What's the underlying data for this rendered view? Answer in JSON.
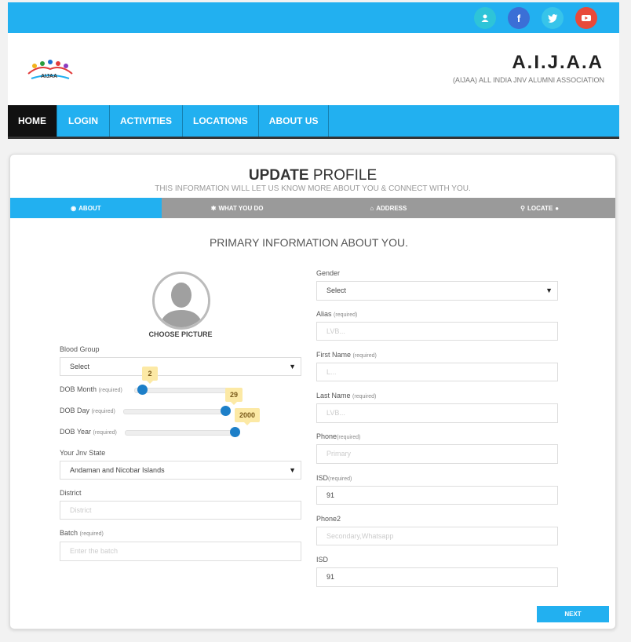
{
  "social": {
    "user_icon": "👤",
    "facebook_icon": "f",
    "twitter_icon": "🐦",
    "youtube_icon": "▶",
    "colors": {
      "user": "#2ec4d8",
      "facebook": "#3b6fd6",
      "twitter": "#37c4ea",
      "youtube": "#e8493a"
    }
  },
  "header": {
    "brand": "A.I.J.A.A",
    "brand_sub": "(AIJAA) ALL INDIA JNV ALUMNI ASSOCIATION",
    "logo_text": "AIJAA"
  },
  "nav": [
    "HOME",
    "LOGIN",
    "ACTIVITIES",
    "LOCATIONS",
    "ABOUT US"
  ],
  "page": {
    "title_bold": "UPDATE",
    "title_rest": " PROFILE",
    "subtitle": "THIS INFORMATION WILL LET US KNOW MORE ABOUT YOU & CONNECT WITH YOU.",
    "tabs": [
      "ABOUT",
      "WHAT YOU DO",
      "ADDRESS",
      "LOCATE"
    ],
    "section_title": "PRIMARY INFORMATION ABOUT YOU.",
    "choose_picture": "CHOOSE PICTURE",
    "next": "NEXT"
  },
  "left": {
    "blood_group": {
      "label": "Blood Group",
      "value": "Select"
    },
    "dob_month": {
      "label": "DOB Month",
      "req": "(required)",
      "value": "2",
      "fraction": 0.08
    },
    "dob_day": {
      "label": "DOB Day",
      "req": "(required)",
      "value": "29",
      "fraction": 0.92
    },
    "dob_year": {
      "label": "DOB Year",
      "req": "(required)",
      "value": "2000",
      "fraction": 0.95
    },
    "jnv_state": {
      "label": "Your Jnv State",
      "value": "Andaman and Nicobar Islands"
    },
    "district": {
      "label": "District",
      "placeholder": "District"
    },
    "batch": {
      "label": "Batch",
      "req": "(required)",
      "placeholder": "Enter the batch"
    }
  },
  "right": {
    "gender": {
      "label": "Gender",
      "value": "Select"
    },
    "alias": {
      "label": "Alias",
      "req": "(required)",
      "placeholder": "LVB..."
    },
    "first_name": {
      "label": "First Name",
      "req": "(required)",
      "placeholder": "L..."
    },
    "last_name": {
      "label": "Last Name",
      "req": "(required)",
      "placeholder": "LVB..."
    },
    "phone": {
      "label": "Phone",
      "req": "(required)",
      "placeholder": "Primary"
    },
    "isd": {
      "label": "ISD",
      "req": "(required)",
      "value": "91"
    },
    "phone2": {
      "label": "Phone2",
      "placeholder": "Secondary,Whatsapp"
    },
    "isd2": {
      "label": "ISD",
      "value": "91"
    }
  }
}
